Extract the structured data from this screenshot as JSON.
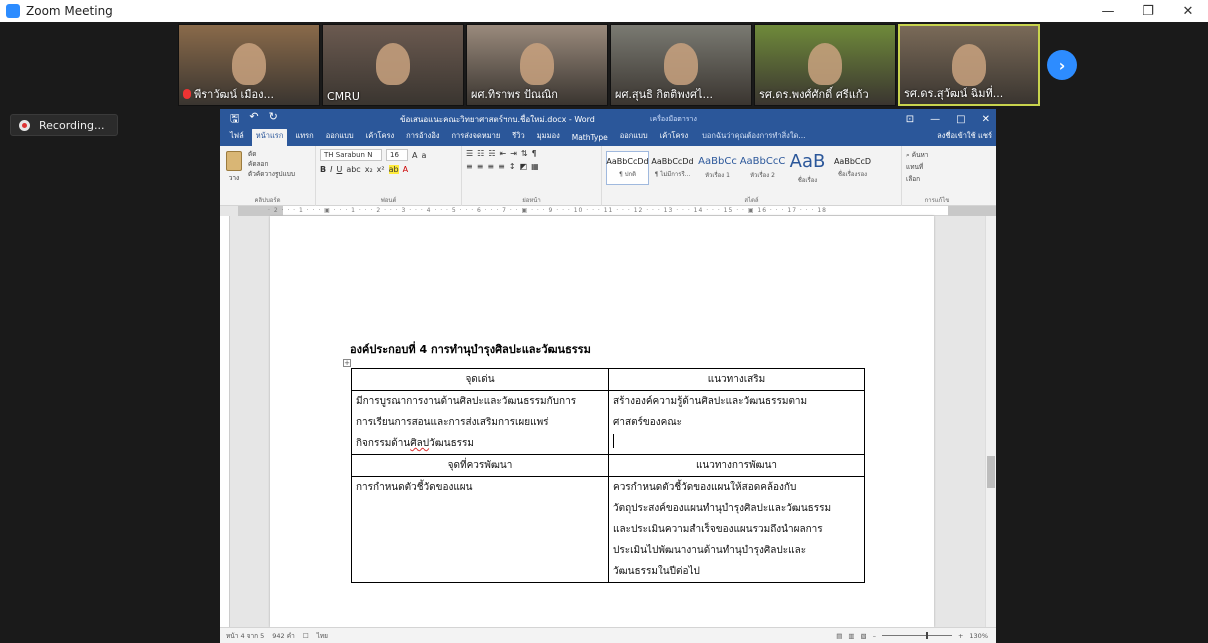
{
  "window": {
    "title": "Zoom Meeting",
    "controls": [
      "—",
      "❐",
      "✕"
    ]
  },
  "gallery": [
    {
      "name": "พีราวัฒน์ เมือง...",
      "muted": true,
      "active": false,
      "bg": "#8a6a4a"
    },
    {
      "name": "CMRU",
      "muted": false,
      "active": false,
      "bg": "#6b5a50"
    },
    {
      "name": "ผศ.ทิราพร ปัณณิก",
      "muted": false,
      "active": false,
      "bg": "#9a8a7c"
    },
    {
      "name": "ผศ.สุนธิ กิตติพงศไ...",
      "muted": false,
      "active": false,
      "bg": "#7a7a72"
    },
    {
      "name": "รศ.ดร.พงศ์ศักดิ์ ศรีแก้ว",
      "muted": false,
      "active": false,
      "bg": "#6f8a3a"
    },
    {
      "name": "รศ.ดร.สุวัฒน์ ฉิมที่...",
      "muted": false,
      "active": true,
      "bg": "#7a6a58"
    }
  ],
  "next_label": "›",
  "recording_label": "Recording...",
  "word": {
    "doc_title": "ข้อเสนอแนะคณะวิทยาศาสตร์ฯกบ.ชื่อใหม่.docx - Word",
    "context_tab": "เครื่องมือตาราง",
    "qat": [
      "🖫",
      "↶",
      "↻"
    ],
    "ctrls": [
      "⊡",
      "—",
      "□",
      "✕"
    ],
    "tabs": [
      "ไฟล์",
      "หน้าแรก",
      "แทรก",
      "ออกแบบ",
      "เค้าโครง",
      "การอ้างอิง",
      "การส่งจดหมาย",
      "รีวิว",
      "มุมมอง",
      "MathType",
      "ออกแบบ",
      "เค้าโครง"
    ],
    "selected_tab": 1,
    "search_hint": "บอกฉันว่าคุณต้องการทำสิ่งใด...",
    "share": "ลงชื่อเข้าใช้  แชร์",
    "clipboard": {
      "paste": "วาง",
      "items": [
        "ตัด",
        "คัดลอก",
        "ตัวคัดวางรูปแบบ"
      ],
      "label": "คลิปบอร์ด"
    },
    "font": {
      "name": "TH Sarabun N",
      "size": "16",
      "label": "ฟอนต์"
    },
    "paragraph_label": "ย่อหน้า",
    "styles": [
      {
        "preview": "AaBbCcDd",
        "name": "¶ ปกติ",
        "kind": "n"
      },
      {
        "preview": "AaBbCcDd",
        "name": "¶ ไม่มีการรี...",
        "kind": "n"
      },
      {
        "preview": "AaBbCc",
        "name": "หัวเรื่อง 1",
        "kind": "h"
      },
      {
        "preview": "AaBbCcC",
        "name": "หัวเรื่อง 2",
        "kind": "h"
      },
      {
        "preview": "AaB",
        "name": "ชื่อเรื่อง",
        "kind": "big"
      },
      {
        "preview": "AaBbCcD",
        "name": "ชื่อเรื่องรอง",
        "kind": "n"
      }
    ],
    "styles_label": "สไตล์",
    "editing": {
      "items": [
        "ค้นหา",
        "แทนที่",
        "เลือก"
      ],
      "label": "การแก้ไข"
    },
    "ruler_nums": "· 2 · · · 1 · · · ▣ · · · 1 · · · 2 · · · 3 · · · 4 · · · 5 · · · 6 · · · 7 · · ▣ · · · 9 · · · 10 · · · 11 · · · 12 · · · 13 · · · 14 · · · 15 · · ▣ 16 · · · 17 · · · 18",
    "heading": "องค์ประกอบที่ 4 การทำนุบำรุงศิลปะและวัฒนธรรม",
    "table": {
      "h1": [
        "จุดเด่น",
        "แนวทางเสริม"
      ],
      "r1": [
        "มีการบูรณาการงานด้านศิลปะและวัฒนธรรมกับการ",
        "สร้างองค์ความรู้ด้านศิลปะและวัฒนธรรมตาม"
      ],
      "r1b": [
        "การเรียนการสอนและการส่งเสริมการเผยแพร่",
        "ศาสตร์ของคณะ"
      ],
      "r1c_pre": "กิจกรรมด้าน",
      "r1c_err": "ศิลป",
      "r1c_post": "วัฒนธรรม",
      "h2": [
        "จุดที่ควรพัฒนา",
        "แนวทางการพัฒนา"
      ],
      "r2a": "การกำหนดตัวชี้วัดของแผน",
      "r2b": [
        "ควรกำหนดตัวชี้วัดของแผนให้สอดคล้องกับ",
        "วัตถุประสงค์ของแผนทำนุบำรุงศิลปะและวัฒนธรรม",
        "และประเมินความสำเร็จของแผนรวมถึงนำผลการ",
        "ประเมินไปพัฒนางานด้านทำนุบำรุงศิลปะและ",
        "วัฒนธรรมในปีต่อไป"
      ]
    },
    "status": {
      "page": "หน้า 4 จาก 5",
      "words": "942 คำ",
      "lang": "ไทย",
      "zoom": "130%"
    }
  }
}
